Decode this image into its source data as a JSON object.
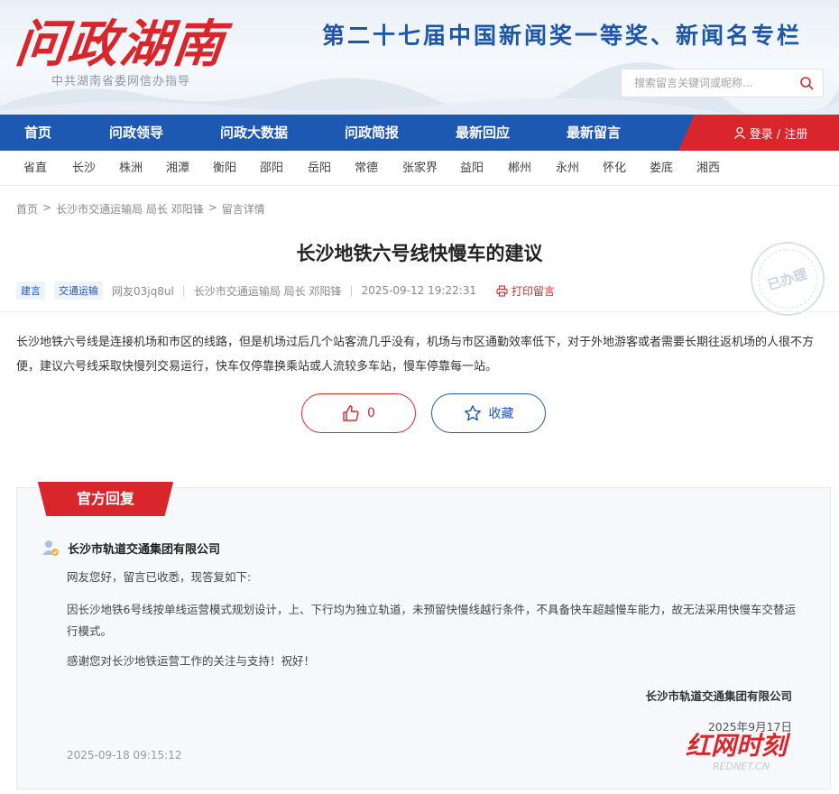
{
  "header": {
    "logo_text": "问政湖南",
    "logo_sub": "中共湖南省委网信办指导",
    "slogan": "第二十七届中国新闻奖一等奖、新闻名专栏",
    "search_placeholder": "搜索留言关键词或昵称..."
  },
  "nav": {
    "items": [
      "首页",
      "问政领导",
      "问政大数据",
      "问政简报",
      "最新回应",
      "最新留言"
    ],
    "login_label": "登录 / 注册"
  },
  "cities": [
    "省直",
    "长沙",
    "株洲",
    "湘潭",
    "衡阳",
    "邵阳",
    "岳阳",
    "常德",
    "张家界",
    "益阳",
    "郴州",
    "永州",
    "怀化",
    "娄底",
    "湘西"
  ],
  "breadcrumb": [
    "首页",
    ">",
    "长沙市交通运输局 局长 邓阳锋",
    ">",
    "留言详情"
  ],
  "post": {
    "title": "长沙地铁六号线快慢车的建议",
    "tags": [
      "建言",
      "交通运输"
    ],
    "author": "网友03jq8ul",
    "target": "长沙市交通运输局 局长 邓阳锋",
    "time": "2025-09-12 19:22:31",
    "print_label": "打印留言",
    "status_stamp": "已办理",
    "content": "长沙地铁六号线是连接机场和市区的线路，但是机场过后几个站客流几乎没有，机场与市区通勤效率低下，对于外地游客或者需要长期往返机场的人很不方便，建议六号线采取快慢列交易运行，快车仅停靠换乘站或人流较多车站，慢车停靠每一站。",
    "like_count": "0",
    "favorite_label": "收藏"
  },
  "reply": {
    "tab_label": "官方回复",
    "org": "长沙市轨道交通集团有限公司",
    "paragraphs": [
      "网友您好，留言已收悉，现答复如下:",
      "因长沙地铁6号线按单线运营模式规划设计，上、下行均为独立轨道，未预留快慢线越行条件，不具备快车超越慢车能力，故无法采用快慢车交替运行模式。",
      "感谢您对长沙地铁运营工作的关注与支持！祝好！"
    ],
    "signature": "长沙市轨道交通集团有限公司",
    "sign_date": "2025年9月17日",
    "reply_time": "2025-09-18 09:15:12"
  },
  "watermark": {
    "text_main": "红网时刻",
    "text_sub": "REDNET.CN"
  },
  "colors": {
    "brand_blue": "#1d58b3",
    "brand_red": "#d8262c"
  },
  "icons": [
    "search-icon",
    "user-icon",
    "print-icon",
    "thumbs-up-icon",
    "star-icon",
    "official-user-icon"
  ]
}
